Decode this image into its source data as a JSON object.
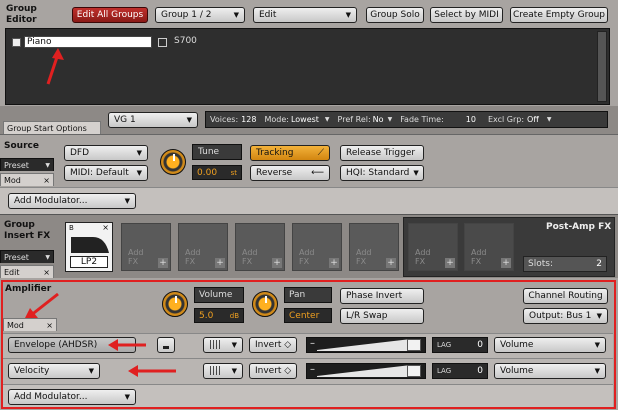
{
  "group_editor": {
    "title_line1": "Group",
    "title_line2": "Editor",
    "toolbar": {
      "edit_all_groups": "Edit All Groups",
      "group_selector": "Group 1 / 2",
      "edit_menu": "Edit",
      "group_solo": "Group Solo",
      "select_by_midi": "Select by MIDI",
      "create_empty_group": "Create Empty Group"
    },
    "groups": [
      {
        "name": "Piano"
      },
      {
        "name": "S700"
      }
    ]
  },
  "group_start_options": {
    "tab_label": "Group Start Options",
    "vg_selector": "VG 1",
    "voices_label": "Voices:",
    "voices_value": "128",
    "mode_label": "Mode:",
    "mode_value": "Lowest",
    "pref_rel_label": "Pref Rel:",
    "pref_rel_value": "No",
    "fade_time_label": "Fade Time:",
    "fade_time_value": "10",
    "excl_grp_label": "Excl Grp:",
    "excl_grp_value": "Off"
  },
  "source": {
    "title": "Source",
    "preset_tab": "Preset",
    "mod_tab": "Mod",
    "close_x": "×",
    "dfd": "DFD",
    "midi": "MIDI: Default",
    "tune_label": "Tune",
    "tune_value": "0.00",
    "tune_unit": "st",
    "tracking": "Tracking",
    "reverse": "Reverse",
    "release_trigger": "Release Trigger",
    "hqi": "HQI: Standard",
    "add_modulator": "Add Modulator..."
  },
  "group_insert_fx": {
    "title_line1": "Group",
    "title_line2": "Insert FX",
    "preset_tab": "Preset",
    "edit_tab": "Edit",
    "close_x": "×",
    "first_slot_tag": "B",
    "first_slot_name": "LP2",
    "empty_slot_line1": "Add",
    "empty_slot_line2": "FX",
    "plus": "+",
    "post_amp_title": "Post-Amp FX",
    "slots_label": "Slots:",
    "slots_value": "2"
  },
  "amplifier": {
    "title": "Amplifier",
    "mod_tab": "Mod",
    "close_x": "×",
    "volume_label": "Volume",
    "volume_value": "5.0",
    "volume_unit": "dB",
    "pan_label": "Pan",
    "pan_value": "Center",
    "phase_invert": "Phase Invert",
    "lr_swap": "L/R Swap",
    "channel_routing": "Channel Routing",
    "output": "Output: Bus 1",
    "modulators": [
      {
        "source": "Envelope (AHDSR)",
        "invert": "Invert ◇",
        "lag_label": "LAG",
        "lag_value": "0",
        "target": "Volume"
      },
      {
        "source": "Velocity",
        "invert": "Invert ◇",
        "lag_label": "LAG",
        "lag_value": "0",
        "target": "Volume"
      }
    ],
    "add_modulator": "Add Modulator..."
  },
  "colors": {
    "accent_red": "#c0302c",
    "tracking_orange": "#f3b23a",
    "highlight_red": "#e02020"
  }
}
